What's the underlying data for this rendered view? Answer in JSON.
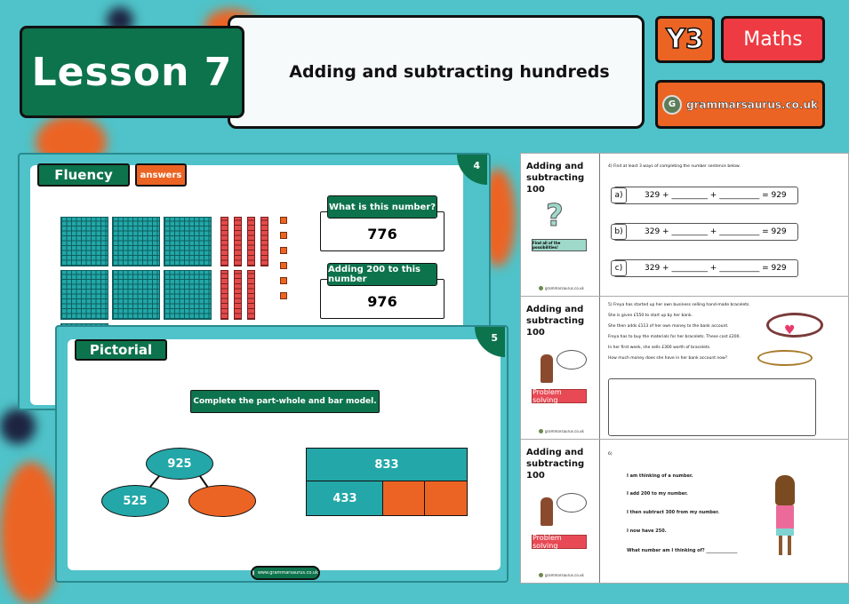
{
  "header": {
    "lesson_label": "Lesson 7",
    "lesson_title": "Adding and subtracting hundreds",
    "year_badge": "Y3",
    "subject_badge": "Maths",
    "brand_url": "grammarsaurus.co.uk",
    "brand_logo_letter": "G"
  },
  "slide_fluency": {
    "tag": "Fluency",
    "answers_tag": "answers",
    "slide_number": "4",
    "base_ten": {
      "hundreds": 7,
      "tens": 7,
      "ones": 6
    },
    "cards": [
      {
        "label": "What is this number?",
        "value": "776"
      },
      {
        "label": "Adding 200 to this number",
        "value": "976"
      }
    ]
  },
  "slide_pictorial": {
    "tag": "Pictorial",
    "slide_number": "5",
    "instruction": "Complete the part-whole and bar model.",
    "part_whole": {
      "whole": "925",
      "part_a": "525",
      "part_b": ""
    },
    "bar_model": {
      "total": "833",
      "part_a": "433",
      "part_b": "",
      "part_c": ""
    },
    "footer_url": "www.grammarsaurus.co.uk"
  },
  "worksheets": [
    {
      "title": "Adding and subtracting 100",
      "badge": "Find all of the possibilities!",
      "question": "4) Find at least 3 ways of completing the number sentence below.",
      "equations": [
        {
          "label": "a)",
          "text": "329 + _________ + __________ = 929"
        },
        {
          "label": "b)",
          "text": "329 + _________ + __________ = 929"
        },
        {
          "label": "c)",
          "text": "329 + _________ + __________ = 929"
        }
      ],
      "brand": "grammarsaurus.co.uk"
    },
    {
      "title": "Adding and subtracting 100",
      "badge": "Problem solving",
      "lines": [
        "5) Freya has started up her own business selling hand-made bracelets.",
        "She is given £550 to start up by her bank.",
        "She then adds £113 of her own money to the bank account.",
        "Freya has to buy the materials for her bracelets. These cost £200.",
        "In her first week, she sells £300 worth of bracelets.",
        "How much money does she have in her bank account now?"
      ],
      "answer_box": "",
      "brand": "grammarsaurus.co.uk"
    },
    {
      "title": "Adding and subtracting 100",
      "badge": "Problem solving",
      "number": "6)",
      "lines": [
        "I am thinking of a number.",
        "I add 200 to my number.",
        "I then subtract 300 from my number.",
        "I now have 250.",
        "What number am I thinking of? ______________"
      ],
      "brand": "grammarsaurus.co.uk"
    }
  ],
  "colors": {
    "teal_bg": "#4fc3c9",
    "green": "#0d734c",
    "orange": "#ec6424",
    "red": "#ee3a42",
    "block_teal": "#23a7a8",
    "block_red": "#e34b4b"
  }
}
